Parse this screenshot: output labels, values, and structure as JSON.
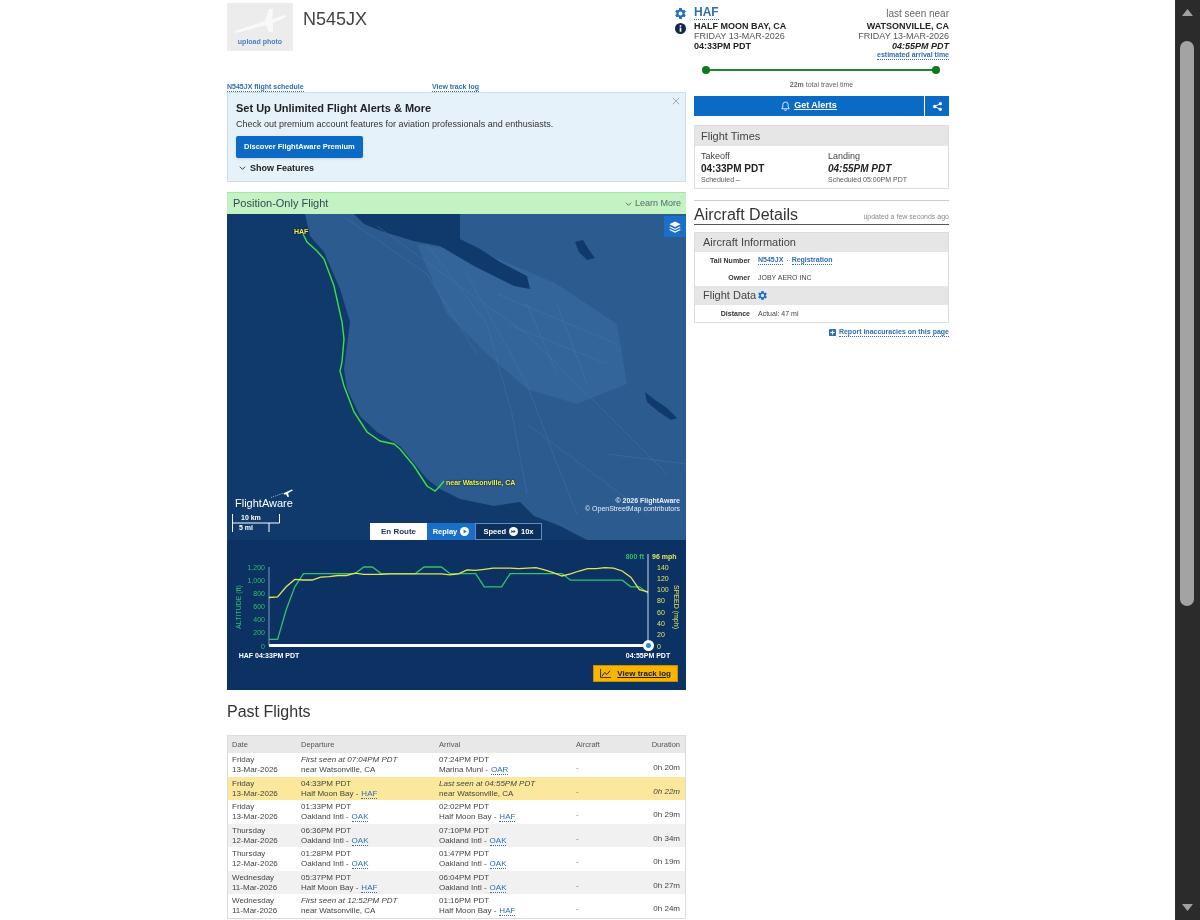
{
  "aircraft": {
    "tail_number": "N545JX",
    "photo_link": "upload photo",
    "links": [
      "N545JX flight schedule",
      "View track log"
    ]
  },
  "promo": {
    "title": "Set Up Unlimited Flight Alerts & More",
    "text": "Check out premium account features for aviation professionals and enthusiasts.",
    "button": "Discover FlightAware Premium",
    "toggle": {
      "label": "Show Features",
      "expanded": false
    }
  },
  "flight_banner": {
    "label": "Position-Only Flight",
    "link": "Learn More"
  },
  "map": {
    "origin_label": "HAF",
    "position_label": "near Watsonville, CA",
    "logo": "FlightAware",
    "scale": [
      "10 km",
      "5 mi"
    ],
    "attribution": [
      "© 2026 FlightAware",
      "© OpenStreetMap contributors"
    ],
    "controls": [
      {
        "kind": "status",
        "label": "En Route"
      },
      {
        "kind": "replay",
        "label": "Replay"
      },
      {
        "kind": "speed",
        "label": "Speed",
        "value": "10x"
      }
    ]
  },
  "track_chart": {
    "chart_data": [
      {
        "type": "line",
        "ylabel": "ALTITUDE (ft)",
        "y2label": "SPEED (mph)",
        "categories": [
          "HAF 04:33PM PDT",
          null,
          null,
          null,
          null,
          null,
          null,
          null,
          null,
          null,
          null,
          null,
          null,
          null,
          null,
          null,
          null,
          null,
          null,
          null,
          null,
          null,
          null,
          null,
          null,
          null,
          null,
          null,
          null,
          null,
          null,
          null,
          null,
          null,
          null,
          null,
          null,
          null,
          null,
          null,
          null,
          null,
          null,
          null,
          "04:55PM PDT"
        ],
        "ylim": [
          0,
          1200
        ],
        "y2lim": [
          0,
          140
        ],
        "yticks": [
          0,
          200,
          400,
          600,
          800,
          {
            "value": 1000,
            "label": "1,000"
          },
          {
            "value": 1200,
            "label": "1,200"
          }
        ],
        "y2ticks": [
          0,
          20,
          40,
          60,
          80,
          100,
          120,
          140
        ],
        "series": [
          {
            "color": "#33c26b",
            "values": [
              100,
              100,
              550,
              900,
              1100,
              1100,
              1100,
              1100,
              1100,
              1100,
              1100,
              1200,
              1200,
              1100,
              1100,
              1100,
              1100,
              1100,
              1200,
              1200,
              1200,
              1100,
              1100,
              1100,
              1100,
              900,
              900,
              900,
              1100,
              1100,
              1100,
              1100,
              1100,
              1100,
              1100,
              1000,
              1000,
              1000,
              1000,
              1000,
              1000,
              1000,
              900,
              900,
              800
            ]
          },
          {
            "color": "#e2e655",
            "axis": "y2",
            "values": [
              86,
              87,
              105,
              118,
              117,
              117,
              122,
              123,
              125,
              125,
              129,
              127,
              127,
              127,
              128,
              128,
              128,
              128,
              128,
              128,
              128,
              126,
              128,
              135,
              134,
              136,
              138,
              138,
              138,
              137,
              138,
              139,
              135,
              130,
              124,
              128,
              133,
              137,
              137,
              139,
              138,
              133,
              122,
              100,
              96
            ]
          }
        ],
        "annotations": [
          "800 ft",
          "96 mph"
        ]
      }
    ],
    "replay_slider": {
      "level": 1
    },
    "button": "View track log"
  },
  "past_flights": {
    "title": "Past Flights",
    "columns": [
      "Date",
      "Departure",
      "Arrival",
      "Aircraft",
      "Duration"
    ],
    "rows": [
      {
        "selected": false,
        "day": "Friday",
        "date": "13-Mar-2026",
        "departure": {
          "time": "First seen at 07:04PM PDT",
          "estimated": true,
          "place": "near Watsonville, CA"
        },
        "arrival": {
          "time": "07:24PM PDT",
          "estimated": false,
          "place": "Marina Muni -",
          "code": "OAR"
        },
        "aircraft": "-",
        "duration": "0h 20m",
        "duration_estimated": false
      },
      {
        "selected": true,
        "day": "Friday",
        "date": "13-Mar-2026",
        "departure": {
          "time": "04:33PM PDT",
          "estimated": false,
          "place": "Half Moon Bay -",
          "code": "HAF"
        },
        "arrival": {
          "time": "Last seen at 04:55PM PDT",
          "estimated": true,
          "place": "near Watsonville, CA"
        },
        "aircraft": "-",
        "duration": "0h 22m",
        "duration_estimated": true
      },
      {
        "selected": false,
        "day": "Friday",
        "date": "13-Mar-2026",
        "departure": {
          "time": "01:33PM PDT",
          "estimated": false,
          "place": "Oakland Intl -",
          "code": "OAK"
        },
        "arrival": {
          "time": "02:02PM PDT",
          "estimated": false,
          "place": "Half Moon Bay -",
          "code": "HAF"
        },
        "aircraft": "-",
        "duration": "0h 29m",
        "duration_estimated": false
      },
      {
        "selected": false,
        "day": "Thursday",
        "date": "12-Mar-2026",
        "departure": {
          "time": "06:36PM PDT",
          "estimated": false,
          "place": "Oakland Intl -",
          "code": "OAK"
        },
        "arrival": {
          "time": "07:10PM PDT",
          "estimated": false,
          "place": "Oakland Intl -",
          "code": "OAK"
        },
        "aircraft": "-",
        "duration": "0h 34m",
        "duration_estimated": false
      },
      {
        "selected": false,
        "day": "Thursday",
        "date": "12-Mar-2026",
        "departure": {
          "time": "01:28PM PDT",
          "estimated": false,
          "place": "Oakland Intl -",
          "code": "OAK"
        },
        "arrival": {
          "time": "01:47PM PDT",
          "estimated": false,
          "place": "Oakland Intl -",
          "code": "OAK"
        },
        "aircraft": "-",
        "duration": "0h 19m",
        "duration_estimated": false
      },
      {
        "selected": false,
        "day": "Wednesday",
        "date": "11-Mar-2026",
        "departure": {
          "time": "05:37PM PDT",
          "estimated": false,
          "place": "Half Moon Bay -",
          "code": "HAF"
        },
        "arrival": {
          "time": "06:04PM PDT",
          "estimated": false,
          "place": "Oakland Intl -",
          "code": "OAK"
        },
        "aircraft": "-",
        "duration": "0h 27m",
        "duration_estimated": false
      },
      {
        "selected": false,
        "day": "Wednesday",
        "date": "11-Mar-2026",
        "departure": {
          "time": "First seen at 12:52PM PDT",
          "estimated": true,
          "place": "near Watsonville, CA"
        },
        "arrival": {
          "time": "01:16PM PDT",
          "estimated": false,
          "place": "Half Moon Bay -",
          "code": "HAF"
        },
        "aircraft": "-",
        "duration": "0h 24m",
        "duration_estimated": false
      }
    ]
  },
  "flight": {
    "origin": {
      "code": "HAF",
      "city": "HALF MOON BAY, CA",
      "date": "FRIDAY 13-MAR-2026",
      "time": "04:33PM PDT",
      "estimated": false
    },
    "destination": {
      "label": "last seen near",
      "city": "WATSONVILLE, CA",
      "date": "FRIDAY 13-MAR-2026",
      "time": "04:55PM PDT",
      "estimated": true,
      "note": "estimated arrival time"
    },
    "progress": {
      "level": 1
    },
    "travel_time": "**22m** total travel time"
  },
  "alerts_button": "Get Alerts",
  "flight_times": {
    "title": "Flight Times",
    "columns": [
      {
        "label": "Takeoff",
        "time": "04:33PM PDT",
        "estimated": false,
        "scheduled": "Scheduled –"
      },
      {
        "label": "Landing",
        "time": "04:55PM PDT",
        "estimated": true,
        "scheduled": "Scheduled 05:00PM PDT"
      }
    ]
  },
  "aircraft_details": {
    "title": "Aircraft Details",
    "updated": "updated a few seconds ago",
    "sections": [
      {
        "title": "Aircraft Information",
        "settings": false,
        "rows": [
          {
            "label": "Tail Number",
            "parts": [
              {
                "text": "N545JX",
                "link": true
              },
              {
                "text": "·",
                "link": false
              },
              {
                "text": "Registration",
                "link": true
              }
            ]
          },
          {
            "label": "Owner",
            "parts": [
              {
                "text": "JOBY AERO INC",
                "link": false
              }
            ]
          }
        ]
      },
      {
        "title": "Flight Data",
        "settings": true,
        "rows": [
          {
            "label": "Distance",
            "parts": [
              {
                "text": "Actual: 47 mi",
                "link": false
              }
            ]
          }
        ]
      }
    ]
  },
  "report_link": "Report inaccuracies on this page"
}
